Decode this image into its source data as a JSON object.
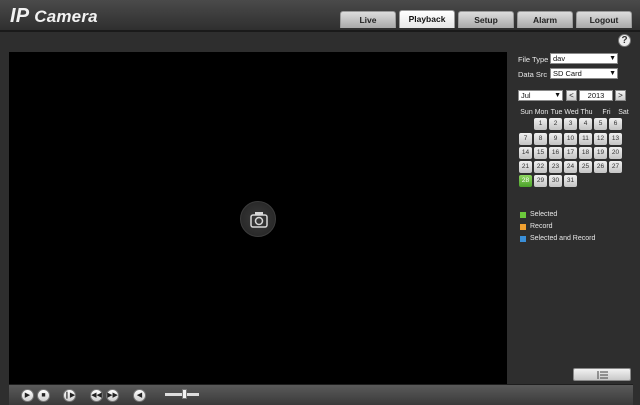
{
  "header": {
    "logo_ip": "IP",
    "logo_rest": "Camera",
    "tabs": [
      {
        "label": "Live"
      },
      {
        "label": "Playback"
      },
      {
        "label": "Setup"
      },
      {
        "label": "Alarm"
      },
      {
        "label": "Logout"
      }
    ],
    "active_tab": "Playback"
  },
  "help": {
    "label": "?"
  },
  "panel": {
    "file_type_label": "File Type",
    "file_type_value": "dav",
    "data_src_label": "Data Src",
    "data_src_value": "SD Card",
    "month_value": "Jul",
    "year_value": "2013",
    "prev_symbol": "<",
    "next_symbol": ">",
    "weekdays": [
      "Sun",
      "Mon",
      "Tue",
      "Wed",
      "Thu",
      "Fri",
      "Sat"
    ],
    "days": [
      "1",
      "2",
      "3",
      "4",
      "5",
      "6",
      "7",
      "8",
      "9",
      "10",
      "11",
      "12",
      "13",
      "14",
      "15",
      "16",
      "17",
      "18",
      "19",
      "20",
      "21",
      "22",
      "23",
      "24",
      "25",
      "26",
      "27",
      "28",
      "29",
      "30",
      "31"
    ],
    "selected_day": "28"
  },
  "legend": [
    {
      "label": "Selected",
      "color": "#6cc93c"
    },
    {
      "label": "Record",
      "color": "#f0a030"
    },
    {
      "label": "Selected and Record",
      "color": "#3a8fd8"
    }
  ],
  "toolbar": {
    "icons": [
      "play-icon",
      "stop-icon",
      "step-forward-icon",
      "slow-icon",
      "fast-icon",
      "volume-icon"
    ],
    "volume_level": 0.55
  }
}
